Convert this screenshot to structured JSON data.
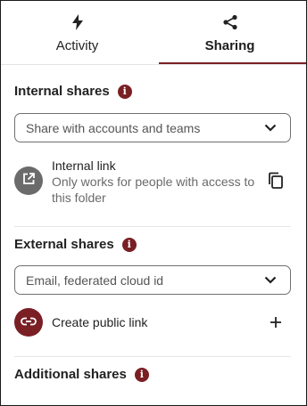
{
  "tabs": [
    {
      "label": "Activity",
      "icon": "lightning-icon",
      "active": false
    },
    {
      "label": "Sharing",
      "icon": "share-icon",
      "active": true
    }
  ],
  "internal": {
    "title": "Internal shares",
    "select_placeholder": "Share with accounts and teams",
    "link_title": "Internal link",
    "link_description": "Only works for people with access to this folder"
  },
  "external": {
    "title": "External shares",
    "select_placeholder": "Email, federated cloud id",
    "create_link_label": "Create public link"
  },
  "additional": {
    "title": "Additional shares"
  },
  "colors": {
    "accent": "#7a1f24",
    "neutral_avatar": "#6b6b6b"
  }
}
